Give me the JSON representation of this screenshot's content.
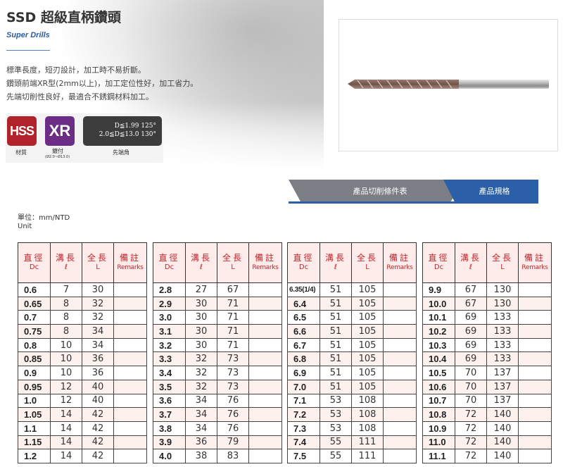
{
  "header": {
    "title": "SSD 超級直柄鑽頭",
    "subtitle": "Super Drills",
    "description": [
      "標準長度，短刃設計，加工時不易折斷。",
      "鑽頭前端XR型(2mm以上)，加工定位性好，加工省力。",
      "先端切削性良好，最適合不銹鋼材料加工。"
    ]
  },
  "badges": {
    "hss": "HSS",
    "xr": "XR",
    "angle_line1": "D≦1.99  125°",
    "angle_line2": "2.0≦D≦13.0  130°",
    "cap_material": "材質",
    "cap_tip": "鍍付",
    "cap_tip_sub": "(Ø2.0~Ø13.0)",
    "cap_angle": "先端角"
  },
  "tabs": [
    {
      "label": "產品切削條件表",
      "active": false
    },
    {
      "label": "產品規格",
      "active": true
    }
  ],
  "unit": {
    "line1": "單位：mm/NTD",
    "line2": "Unit"
  },
  "table_header": {
    "dc_zh": "直徑",
    "dc_en": "Dc",
    "l_zh": "溝長",
    "l_en": "ℓ",
    "L_zh": "全長",
    "L_en": "L",
    "rem_zh": "備註",
    "rem_en": "Remarks"
  },
  "tables": [
    {
      "rows": [
        [
          "0.6",
          "7",
          "30"
        ],
        [
          "0.65",
          "8",
          "32"
        ],
        [
          "0.7",
          "8",
          "32"
        ],
        [
          "0.75",
          "8",
          "34"
        ],
        [
          "0.8",
          "10",
          "34"
        ],
        [
          "0.85",
          "10",
          "36"
        ],
        [
          "0.9",
          "10",
          "36"
        ],
        [
          "0.95",
          "12",
          "40"
        ],
        [
          "1.0",
          "12",
          "40"
        ],
        [
          "1.05",
          "14",
          "42"
        ],
        [
          "1.1",
          "14",
          "42"
        ],
        [
          "1.15",
          "14",
          "42"
        ],
        [
          "1.2",
          "14",
          "42"
        ]
      ]
    },
    {
      "rows": [
        [
          "2.8",
          "27",
          "67"
        ],
        [
          "2.9",
          "30",
          "71"
        ],
        [
          "3.0",
          "30",
          "71"
        ],
        [
          "3.1",
          "30",
          "71"
        ],
        [
          "3.2",
          "30",
          "71"
        ],
        [
          "3.3",
          "32",
          "73"
        ],
        [
          "3.4",
          "32",
          "73"
        ],
        [
          "3.5",
          "32",
          "73"
        ],
        [
          "3.6",
          "34",
          "76"
        ],
        [
          "3.7",
          "34",
          "76"
        ],
        [
          "3.8",
          "34",
          "76"
        ],
        [
          "3.9",
          "36",
          "79"
        ],
        [
          "4.0",
          "38",
          "83"
        ]
      ]
    },
    {
      "rows": [
        [
          "6.35(1/4)",
          "51",
          "105"
        ],
        [
          "6.4",
          "51",
          "105"
        ],
        [
          "6.5",
          "51",
          "105"
        ],
        [
          "6.6",
          "51",
          "105"
        ],
        [
          "6.7",
          "51",
          "105"
        ],
        [
          "6.8",
          "51",
          "105"
        ],
        [
          "6.9",
          "51",
          "105"
        ],
        [
          "7.0",
          "51",
          "105"
        ],
        [
          "7.1",
          "53",
          "108"
        ],
        [
          "7.2",
          "53",
          "108"
        ],
        [
          "7.3",
          "53",
          "108"
        ],
        [
          "7.4",
          "55",
          "111"
        ],
        [
          "7.5",
          "55",
          "111"
        ]
      ]
    },
    {
      "rows": [
        [
          "9.9",
          "67",
          "130"
        ],
        [
          "10.0",
          "67",
          "130"
        ],
        [
          "10.1",
          "69",
          "133"
        ],
        [
          "10.2",
          "69",
          "133"
        ],
        [
          "10.3",
          "69",
          "133"
        ],
        [
          "10.4",
          "69",
          "133"
        ],
        [
          "10.5",
          "70",
          "137"
        ],
        [
          "10.6",
          "70",
          "137"
        ],
        [
          "10.7",
          "70",
          "137"
        ],
        [
          "10.8",
          "72",
          "140"
        ],
        [
          "10.9",
          "72",
          "140"
        ],
        [
          "11.0",
          "72",
          "140"
        ],
        [
          "11.1",
          "72",
          "140"
        ]
      ]
    }
  ],
  "colors": {
    "accent_blue": "#2b5fa8",
    "header_red": "#c4242b",
    "row_tint": "#fdf1ee",
    "hss_red": "#b0232a",
    "xr_purple": "#6b2d86"
  }
}
